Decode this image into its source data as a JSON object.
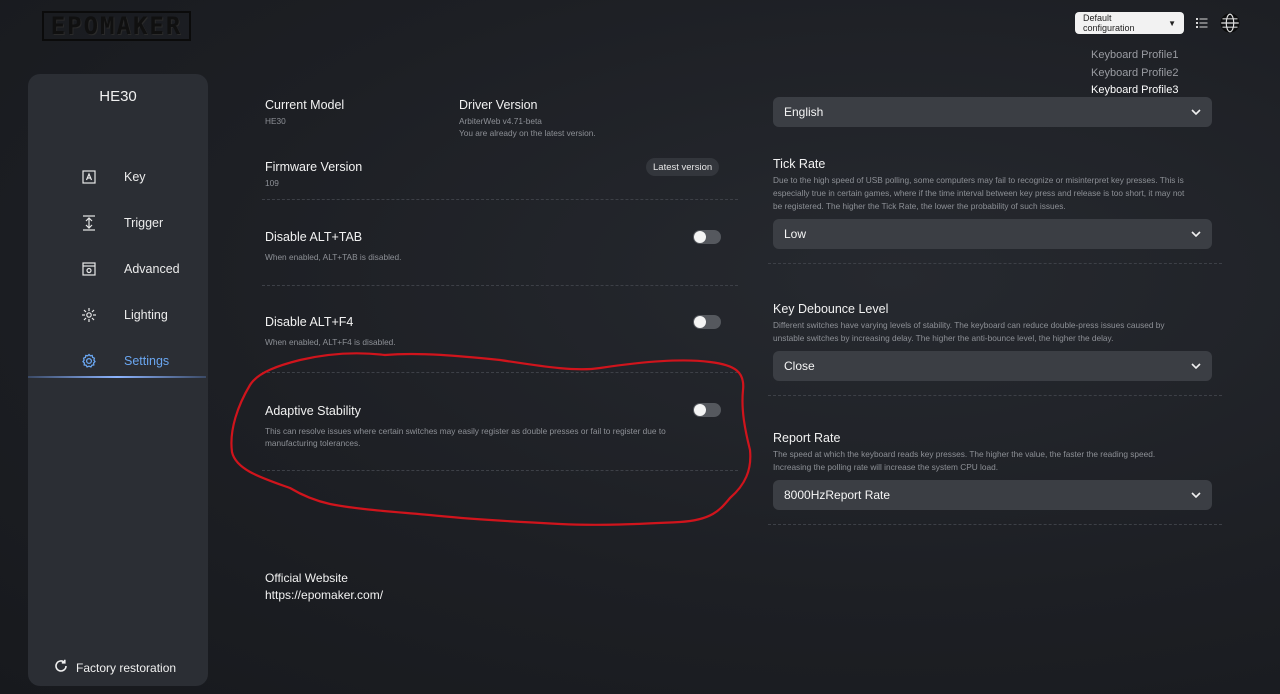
{
  "brand": {
    "logo_text": "EPOMAKER"
  },
  "topbar": {
    "config_select": "Default configuration",
    "profiles": [
      "Keyboard Profile1",
      "Keyboard Profile2",
      "Keyboard Profile3"
    ],
    "active_profile_index": 2
  },
  "sidebar": {
    "model": "HE30",
    "items": [
      {
        "label": "Key",
        "icon": "key-icon"
      },
      {
        "label": "Trigger",
        "icon": "trigger-icon"
      },
      {
        "label": "Advanced",
        "icon": "advanced-icon"
      },
      {
        "label": "Lighting",
        "icon": "lighting-icon"
      },
      {
        "label": "Settings",
        "icon": "settings-icon",
        "active": true
      }
    ],
    "factory_label": "Factory restoration"
  },
  "left": {
    "current_model_label": "Current Model",
    "current_model_value": "HE30",
    "driver_label": "Driver Version",
    "driver_value": "ArbiterWeb v4.71-beta",
    "driver_status": "You are already on the latest version.",
    "firmware_label": "Firmware Version",
    "firmware_value": "109",
    "firmware_badge": "Latest version",
    "alt_tab_label": "Disable ALT+TAB",
    "alt_tab_desc": "When enabled, ALT+TAB is disabled.",
    "alt_tab_on": false,
    "alt_f4_label": "Disable ALT+F4",
    "alt_f4_desc": "When enabled, ALT+F4 is disabled.",
    "alt_f4_on": false,
    "adaptive_label": "Adaptive Stability",
    "adaptive_desc_1": "This can resolve issues where certain switches may easily register as double presses or fail to register due to",
    "adaptive_desc_2": "manufacturing tolerances.",
    "adaptive_on": false,
    "website_label": "Official Website",
    "website_url": "https://epomaker.com/"
  },
  "right": {
    "language_value": "English",
    "tick_label": "Tick Rate",
    "tick_desc_1": "Due to the high speed of USB polling, some computers may fail to recognize or misinterpret key presses. This is",
    "tick_desc_2": "especially true in certain games, where if the time interval between key press and release is too short, it may not",
    "tick_desc_3": "be registered. The higher the Tick Rate, the lower the probability of such issues.",
    "tick_value": "Low",
    "debounce_label": "Key Debounce Level",
    "debounce_desc_1": "Different switches have varying levels of stability. The keyboard can reduce double-press issues caused by",
    "debounce_desc_2": "unstable switches by increasing delay. The higher the anti-bounce level, the higher the delay.",
    "debounce_value": "Close",
    "report_label": "Report Rate",
    "report_desc_1": "The speed at which the keyboard reads key presses. The higher the value, the faster the reading speed.",
    "report_desc_2": "Increasing the polling rate will increase the system CPU load.",
    "report_value": "8000HzReport Rate"
  },
  "colors": {
    "accent": "#6aa6f0",
    "annotation": "#d0141c",
    "panel": "#2b2e34",
    "dropdown": "#3b3e44"
  }
}
